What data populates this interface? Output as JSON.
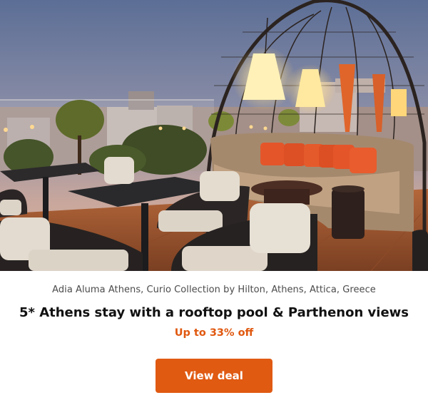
{
  "hero": {
    "alt": "Rooftop terrace lounge with birdcage pergola, lanterns and orange cushions at dusk"
  },
  "offer": {
    "location": "Adia Aluma Athens, Curio Collection by Hilton, Athens, Attica, Greece",
    "headline": "5* Athens stay with a rooftop pool & Parthenon views",
    "discount": "Up to 33% off",
    "cta_label": "View deal"
  },
  "colors": {
    "accent": "#e05a12",
    "discount_text": "#e0580f",
    "text_primary": "#111111",
    "text_secondary": "#4b4b4b"
  }
}
